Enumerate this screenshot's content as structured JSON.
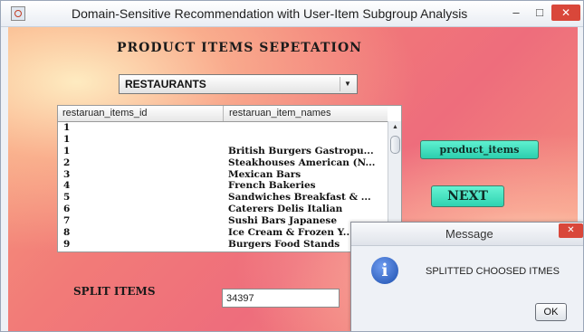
{
  "window": {
    "title": "Domain-Sensitive Recommendation with User-Item Subgroup Analysis",
    "icon": "java-app-icon",
    "minimize_glyph": "–",
    "maximize_glyph": "□",
    "close_glyph": "✕"
  },
  "main": {
    "heading": "PRODUCT ITEMS SEPETATION",
    "category_select": {
      "value": "RESTAURANTS",
      "arrow": "▼"
    },
    "table": {
      "columns": [
        "restaruan_items_id",
        "restaruan_item_names"
      ],
      "rows": [
        {
          "id": "1",
          "name": ""
        },
        {
          "id": "1",
          "name": ""
        },
        {
          "id": "1",
          "name": "British Burgers Gastropu..."
        },
        {
          "id": "2",
          "name": "Steakhouses American (N..."
        },
        {
          "id": "3",
          "name": "Mexican Bars"
        },
        {
          "id": "4",
          "name": "French Bakeries"
        },
        {
          "id": "5",
          "name": "Sandwiches Breakfast & ..."
        },
        {
          "id": "6",
          "name": "Caterers Delis Italian"
        },
        {
          "id": "7",
          "name": "Sushi Bars Japanese"
        },
        {
          "id": "8",
          "name": "Ice Cream & Frozen Y..."
        },
        {
          "id": "9",
          "name": "Burgers Food Stands"
        }
      ],
      "scroll_up_glyph": "▲"
    },
    "product_items_button": "product_items",
    "next_button": "NEXT",
    "split_label": "SPLIT ITEMS",
    "split_value": "34397"
  },
  "dialog": {
    "title": "Message",
    "close_glyph": "✕",
    "icon": "info-icon",
    "icon_glyph": "i",
    "message": "SPLITTED CHOOSED ITMES",
    "ok_button": "OK"
  },
  "colors": {
    "background_gradient": [
      "#f6a07d",
      "#ee6d7c"
    ],
    "button_teal": "#2bcfae",
    "close_red": "#d9473a",
    "info_blue": "#1c4fae"
  }
}
